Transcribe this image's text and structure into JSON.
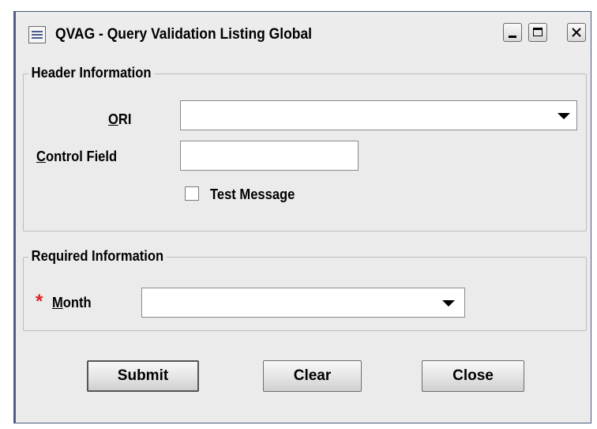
{
  "window": {
    "title": "QVAG - Query Validation Listing Global"
  },
  "header_section": {
    "legend": "Header Information",
    "ori_label_mnemonic": "O",
    "ori_label_rest": "RI",
    "ori_value": "",
    "control_label_mnemonic": "C",
    "control_label_rest": "ontrol Field",
    "control_value": "",
    "test_message_label": "Test Message",
    "test_message_checked": false
  },
  "required_section": {
    "legend": "Required Information",
    "required_marker": "*",
    "month_label_mnemonic": "M",
    "month_label_rest": "onth",
    "month_value": ""
  },
  "buttons": {
    "submit": "Submit",
    "clear": "Clear",
    "close": "Close"
  }
}
